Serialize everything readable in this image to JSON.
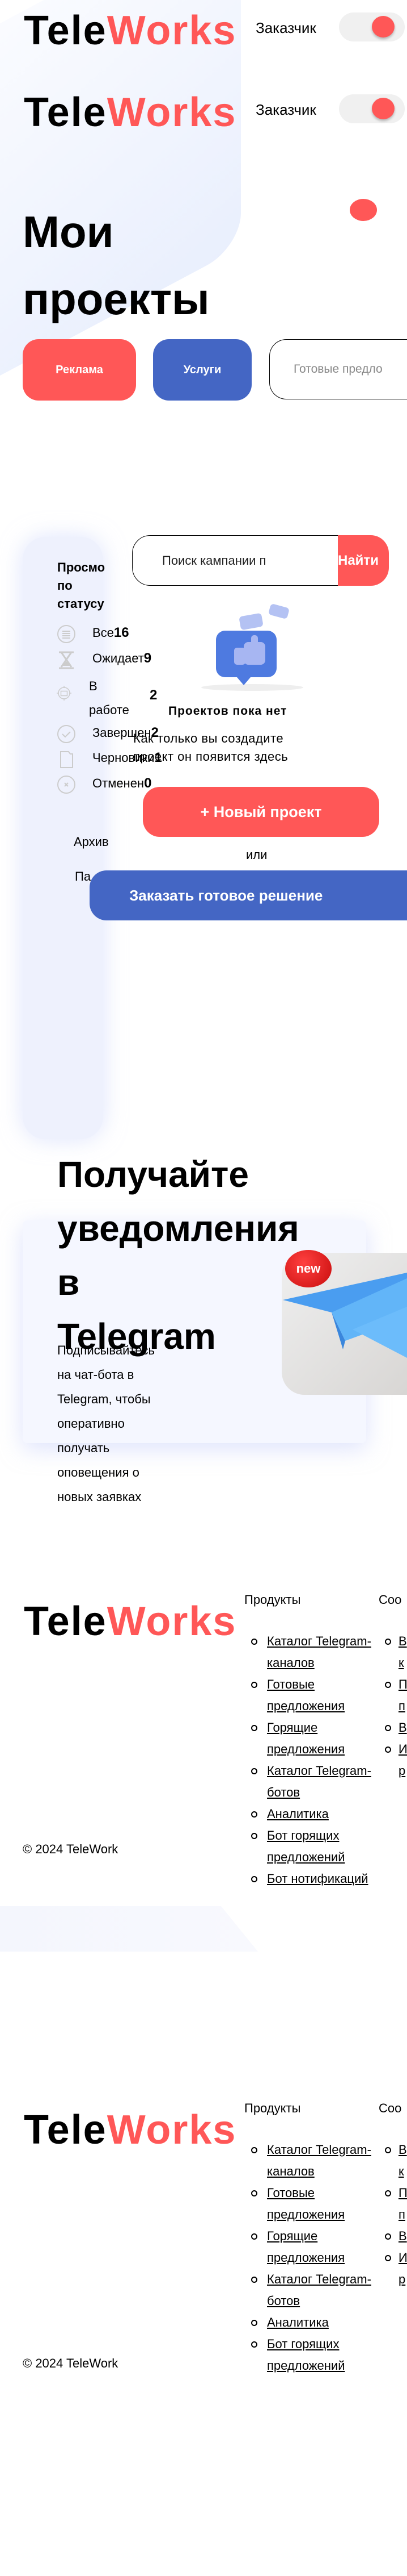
{
  "header": {
    "logo_part1": "Tele",
    "logo_part2": "Works",
    "role_label": "Заказчик",
    "role_toggle_on": true
  },
  "page_title_line1": "Мои",
  "page_title_line2": "проекты",
  "tabs": {
    "ads": "Реклама",
    "services": "Услуги",
    "offers_placeholder": "Готовые предло"
  },
  "search": {
    "placeholder": "Поиск кампании п",
    "button": "Найти"
  },
  "sidebar": {
    "title_line1": "Просмо",
    "title_line2": "по",
    "title_line3": "статусу",
    "statuses": [
      {
        "icon": "list-icon",
        "label": "Все",
        "count": "16"
      },
      {
        "icon": "hourglass-icon",
        "label": "Ожидает",
        "count": "9"
      },
      {
        "icon": "briefcase-icon",
        "label_line1": "В",
        "label_line2": "работе",
        "count": "2"
      },
      {
        "icon": "check-circle-icon",
        "label": "Завершен",
        "count": "2"
      },
      {
        "icon": "file-icon",
        "label": "Черновики",
        "count": "1"
      },
      {
        "icon": "x-circle-icon",
        "label": "Отменен",
        "count": "0"
      }
    ],
    "archive": "Архив",
    "partial_link": "Па"
  },
  "empty_state": {
    "title": "Проектов пока нет",
    "text_line1": "Как только вы создадите",
    "text_line2": "проект он появится здесь",
    "new_project": "+ Новый проект",
    "or": "или",
    "order_solution": "Заказать готовое решение"
  },
  "telegram": {
    "heading_lines": [
      "Получайте",
      "уведомления",
      "в",
      "Telegram"
    ],
    "text_lines": [
      "Подписывайтесь",
      "на чат-бота в",
      "Telegram, чтобы",
      "оперативно",
      "получать",
      "оповещения о",
      "новых заявках"
    ],
    "badge": "new"
  },
  "footer": {
    "logo_part1": "Tele",
    "logo_part2": "Works",
    "copyright": "© 2024 TeleWork",
    "products_title": "Продукты",
    "products": [
      "Каталог Telegram-каналов",
      "Готовые предложения",
      "Горящие предложения",
      "Каталог Telegram-ботов",
      "Аналитика",
      "Бот горящих предложений",
      "Бот нотификаций"
    ],
    "col2_title": "Соо",
    "col2_fragments": [
      "В",
      "к",
      "П",
      "п",
      "В",
      "И",
      "р"
    ]
  },
  "colors": {
    "accent_red": "#ff5757",
    "accent_blue": "#4466c4",
    "card_bg": "#eef1fd"
  }
}
